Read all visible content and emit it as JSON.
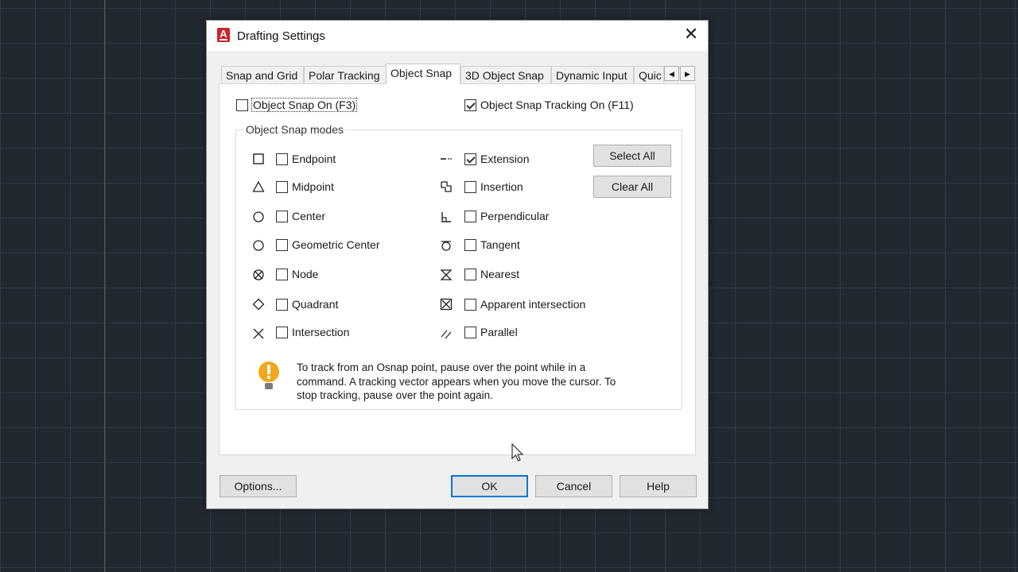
{
  "window": {
    "title": "Drafting Settings",
    "close_glyph": "✕"
  },
  "tabs": [
    {
      "label": "Snap and Grid"
    },
    {
      "label": "Polar Tracking"
    },
    {
      "label": "Object Snap"
    },
    {
      "label": "3D Object Snap"
    },
    {
      "label": "Dynamic Input"
    },
    {
      "label": "Quic"
    }
  ],
  "tab_scroll": {
    "left": "◀",
    "right": "▶"
  },
  "object_snap_on": {
    "label": "Object Snap On (F3)",
    "checked": false
  },
  "object_snap_tracking_on": {
    "label": "Object Snap Tracking On (F11)",
    "checked": true
  },
  "modes": {
    "title": "Object Snap modes",
    "left": [
      {
        "label": "Endpoint",
        "icon": "endpoint-marker-icon",
        "checked": false
      },
      {
        "label": "Midpoint",
        "icon": "midpoint-marker-icon",
        "checked": false
      },
      {
        "label": "Center",
        "icon": "center-marker-icon",
        "checked": false
      },
      {
        "label": "Geometric Center",
        "icon": "geometric-center-marker-icon",
        "checked": false
      },
      {
        "label": "Node",
        "icon": "node-marker-icon",
        "checked": false
      },
      {
        "label": "Quadrant",
        "icon": "quadrant-marker-icon",
        "checked": false
      },
      {
        "label": "Intersection",
        "icon": "intersection-marker-icon",
        "checked": false
      }
    ],
    "right": [
      {
        "label": "Extension",
        "icon": "extension-marker-icon",
        "checked": true
      },
      {
        "label": "Insertion",
        "icon": "insertion-marker-icon",
        "checked": false
      },
      {
        "label": "Perpendicular",
        "icon": "perpendicular-marker-icon",
        "checked": false
      },
      {
        "label": "Tangent",
        "icon": "tangent-marker-icon",
        "checked": false
      },
      {
        "label": "Nearest",
        "icon": "nearest-marker-icon",
        "checked": false
      },
      {
        "label": "Apparent intersection",
        "icon": "apparent-intersection-marker-icon",
        "checked": false
      },
      {
        "label": "Parallel",
        "icon": "parallel-marker-icon",
        "checked": false
      }
    ],
    "select_all_label": "Select All",
    "clear_all_label": "Clear All"
  },
  "info": {
    "icon": "lightbulb-icon",
    "line1": "To track from an Osnap point, pause over the point while in a",
    "line2": "command.  A tracking vector appears when you move the cursor.  To",
    "line3": "stop tracking, pause over the point again."
  },
  "footer": {
    "options_label": "Options...",
    "ok_label": "OK",
    "cancel_label": "Cancel",
    "help_label": "Help"
  },
  "colors": {
    "accent": "#0078d7",
    "app_icon": "#c8242b",
    "info_bulb": "#f0a81c"
  }
}
